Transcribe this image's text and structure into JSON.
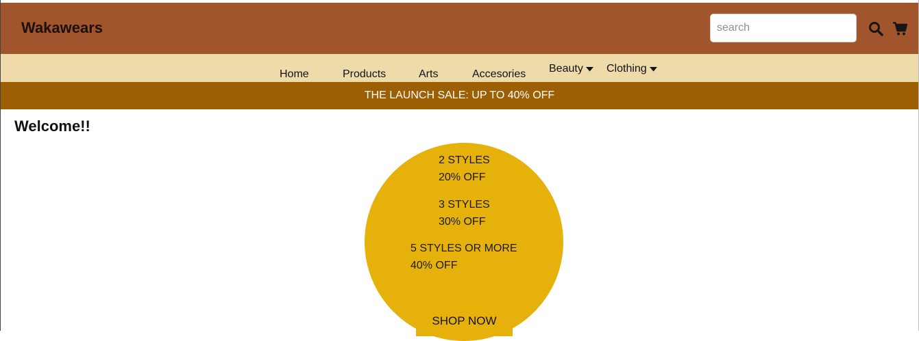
{
  "header": {
    "logo": "Wakawears",
    "search_placeholder": "search",
    "search_icon": "search-icon",
    "cart_icon": "cart-icon"
  },
  "nav": {
    "items": [
      {
        "label": "Home"
      },
      {
        "label": "Products"
      },
      {
        "label": "Arts"
      },
      {
        "label": "Accesories"
      },
      {
        "label": "Beauty",
        "dropdown": true
      },
      {
        "label": "Clothing",
        "dropdown": true
      }
    ]
  },
  "banner": {
    "text": "THE LAUNCH SALE: UP TO 40% OFF"
  },
  "main": {
    "welcome": "Welcome!!",
    "offers": [
      {
        "styles": "2 STYLES",
        "discount": "20% OFF"
      },
      {
        "styles": "3 STYLES",
        "discount": "30% OFF"
      },
      {
        "styles": "5 STYLES OR MORE",
        "discount": "40% OFF"
      }
    ],
    "cta": "SHOP NOW"
  },
  "colors": {
    "header_bg": "#a0552c",
    "nav_bg": "#efdba9",
    "banner_bg": "#9c5f04",
    "circle_bg": "#e6b10b"
  }
}
